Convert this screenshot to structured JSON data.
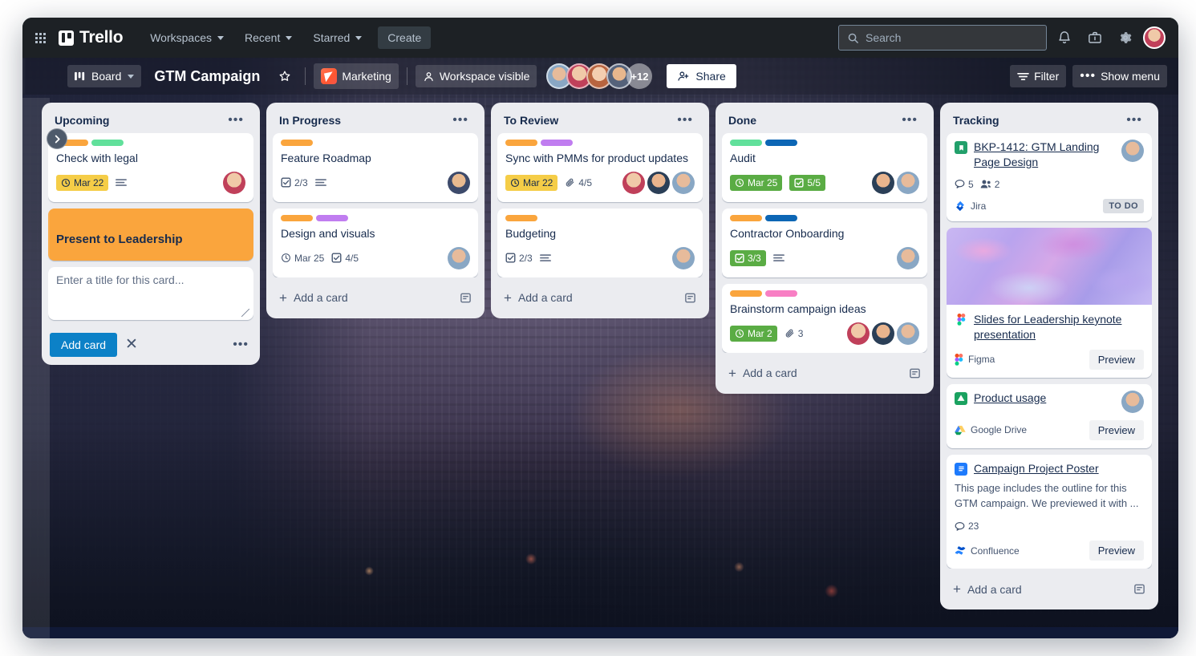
{
  "topnav": {
    "apps_icon": "apps-grid-icon",
    "brand": "Trello",
    "workspaces": "Workspaces",
    "recent": "Recent",
    "starred": "Starred",
    "create": "Create",
    "search_placeholder": "Search",
    "notifications_icon": "bell-icon",
    "briefcase_icon": "briefcase-icon",
    "settings_icon": "gear-icon"
  },
  "boardbar": {
    "board_switch": "Board",
    "title": "GTM Campaign",
    "star_icon": "star-icon",
    "workspace": "Marketing",
    "visibility": "Workspace visible",
    "member_overflow": "+12",
    "share": "Share",
    "filter": "Filter",
    "show_menu": "Show menu",
    "sidebar_toggle_icon": "chevron-right-icon"
  },
  "lists": [
    {
      "name": "Upcoming",
      "menu_icon": "list-actions-icon",
      "cards": [
        {
          "type": "standard",
          "title": "Check with legal",
          "labels": [
            "#faa53d",
            "#61e09b"
          ],
          "due": {
            "text": "Mar 22",
            "state": "due-yellow",
            "icon": "clock-icon"
          },
          "description_icon": "description-icon",
          "avatars": [
            "av-a"
          ]
        }
      ],
      "highlight_card": {
        "title": "Present to Leadership",
        "color": "#faa53d"
      },
      "compose": {
        "placeholder": "Enter a title for this card...",
        "add_label": "Add card",
        "close_icon": "close-icon",
        "more_icon": "more-options-icon"
      }
    },
    {
      "name": "In Progress",
      "menu_icon": "list-actions-icon",
      "cards": [
        {
          "type": "standard",
          "title": "Feature Roadmap",
          "labels": [
            "#faa53d"
          ],
          "checklist": {
            "text": "2/3",
            "state": "plain"
          },
          "description_icon": "description-icon",
          "avatars": [
            "av-b"
          ]
        },
        {
          "type": "standard",
          "title": "Design and visuals",
          "labels": [
            "#faa53d",
            "#c07df0"
          ],
          "due": {
            "text": "Mar 25",
            "state": "plain",
            "icon": "clock-icon"
          },
          "checklist": {
            "text": "4/5",
            "state": "plain"
          },
          "avatars": [
            "av-d"
          ]
        }
      ],
      "add_card": "Add a card",
      "template_icon": "card-template-icon"
    },
    {
      "name": "To Review",
      "menu_icon": "list-actions-icon",
      "cards": [
        {
          "type": "standard",
          "title": "Sync with PMMs for product updates",
          "labels": [
            "#faa53d",
            "#c07df0"
          ],
          "due": {
            "text": "Mar 22",
            "state": "due-yellow",
            "icon": "clock-icon"
          },
          "attachments": {
            "text": "4/5",
            "icon": "attachment-icon"
          },
          "avatars": [
            "av-a",
            "av-c",
            "av-d"
          ]
        },
        {
          "type": "standard",
          "title": "Budgeting",
          "labels": [
            "#faa53d"
          ],
          "checklist": {
            "text": "2/3",
            "state": "plain"
          },
          "description_icon": "description-icon",
          "avatars": [
            "av-d"
          ]
        }
      ],
      "add_card": "Add a card",
      "template_icon": "card-template-icon"
    },
    {
      "name": "Done",
      "menu_icon": "list-actions-icon",
      "cards": [
        {
          "type": "standard",
          "title": "Audit",
          "labels": [
            "#61e09b",
            "#0c66b5"
          ],
          "due": {
            "text": "Mar 25",
            "state": "done-green2",
            "icon": "clock-icon"
          },
          "checklist": {
            "text": "5/5",
            "state": "done-green2"
          },
          "avatars": [
            "av-c",
            "av-d"
          ]
        },
        {
          "type": "standard",
          "title": "Contractor Onboarding",
          "labels": [
            "#faa53d",
            "#0c66b5"
          ],
          "checklist": {
            "text": "3/3",
            "state": "done-green2"
          },
          "description_icon": "description-icon",
          "avatars": [
            "av-d"
          ]
        },
        {
          "type": "standard",
          "title": "Brainstorm campaign ideas",
          "labels": [
            "#faa53d",
            "#f87fc4"
          ],
          "due": {
            "text": "Mar 2",
            "state": "done-green2",
            "icon": "clock-icon"
          },
          "attachments": {
            "text": "3",
            "icon": "attachment-icon"
          },
          "avatars": [
            "av-a",
            "av-c",
            "av-d"
          ]
        }
      ],
      "add_card": "Add a card",
      "template_icon": "card-template-icon"
    },
    {
      "name": "Tracking",
      "menu_icon": "list-actions-icon",
      "smart_cards": [
        {
          "kind": "jira",
          "icon": "jira-issue-icon",
          "title": "BKP-1412: GTM Landing Page Design",
          "comments": "5",
          "members": "2",
          "comments_icon": "comment-icon",
          "members_icon": "members-icon",
          "provider": "Jira",
          "provider_icon": "jira-icon",
          "status": "TO DO",
          "avatars": [
            "av-d"
          ]
        },
        {
          "kind": "figma",
          "icon": "figma-icon",
          "cover": "figma-preview-image",
          "title": "Slides for Leadership keynote presentation",
          "provider": "Figma",
          "provider_icon": "figma-icon",
          "action": "Preview"
        },
        {
          "kind": "gdrive",
          "icon": "google-drive-icon",
          "title": "Product usage",
          "provider": "Google Drive",
          "provider_icon": "google-drive-icon",
          "action": "Preview",
          "avatars": [
            "av-d"
          ]
        },
        {
          "kind": "confluence",
          "icon": "confluence-page-icon",
          "title": "Campaign Project Poster",
          "description": "This page includes the outline for this GTM campaign. We previewed it with ...",
          "comments": "23",
          "comments_icon": "comment-icon",
          "provider": "Confluence",
          "provider_icon": "confluence-icon",
          "action": "Preview"
        }
      ],
      "add_card": "Add a card",
      "template_icon": "card-template-icon"
    }
  ]
}
